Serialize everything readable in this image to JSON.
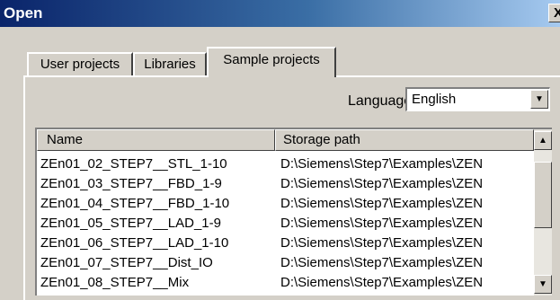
{
  "window": {
    "title": "Open",
    "close_glyph": "X"
  },
  "tabs": [
    {
      "label": "User projects"
    },
    {
      "label": "Libraries"
    },
    {
      "label": "Sample projects",
      "selected": true
    }
  ],
  "language": {
    "label": "Language",
    "value": "English"
  },
  "list": {
    "columns": [
      "Name",
      "Storage path"
    ],
    "rows": [
      {
        "name": "ZEn01_02_STEP7__STL_1-10",
        "path": "D:\\Siemens\\Step7\\Examples\\ZEN"
      },
      {
        "name": "ZEn01_03_STEP7__FBD_1-9",
        "path": "D:\\Siemens\\Step7\\Examples\\ZEN"
      },
      {
        "name": "ZEn01_04_STEP7__FBD_1-10",
        "path": "D:\\Siemens\\Step7\\Examples\\ZEN"
      },
      {
        "name": "ZEn01_05_STEP7__LAD_1-9",
        "path": "D:\\Siemens\\Step7\\Examples\\ZEN"
      },
      {
        "name": "ZEn01_06_STEP7__LAD_1-10",
        "path": "D:\\Siemens\\Step7\\Examples\\ZEN"
      },
      {
        "name": "ZEn01_07_STEP7__Dist_IO",
        "path": "D:\\Siemens\\Step7\\Examples\\ZEN"
      },
      {
        "name": "ZEn01_08_STEP7__Mix",
        "path": "D:\\Siemens\\Step7\\Examples\\ZEN"
      }
    ]
  }
}
